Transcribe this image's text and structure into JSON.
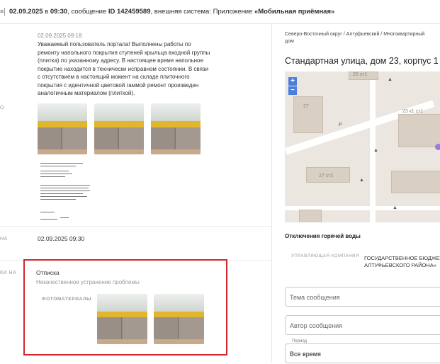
{
  "topbar": {
    "edge_icon": "≡",
    "date": "02.09.2025",
    "prep": "в",
    "time": "09:30",
    "msg_prefix": ", сообщение",
    "msg_id": "ID 142459589",
    "system_label": ", внешняя система: Приложение",
    "system_name": "«Мобильная приёмная»"
  },
  "message": {
    "date": "02.09.2025 09:18",
    "text": "Уважаемый пользователь портала! Выполнены работы по ремонту напольного покрытия ступеней крыльца входной группы (плитка) по указанному адресу. В настоящее время напольное покрытие находится в технически исправном состоянии. В связи с отсутствием в настоящий момент на складе плиточного покрытия с идентичной цветовой гаммой ремонт произведен аналогичным материалом (плиткой).",
    "side_letter": "О"
  },
  "status_row": {
    "side_label": "НА",
    "date": "02.09.2025 09:30"
  },
  "reply": {
    "side_label": "КИ НА",
    "title": "Отписка",
    "subtitle": "Некачественное устранение проблемы",
    "photos_label": "ФОТОМАТЕРИАЛЫ"
  },
  "right": {
    "address": "Северо-Восточный округ / Алтуфьевский / Многоквартирный дом",
    "street": "Стандартная улица, дом 23, корпус 1",
    "map": {
      "zoom_in": "+",
      "zoom_out": "−",
      "labels": [
        "25 ст1",
        "27",
        "23 к1 ст1",
        "27 ст2"
      ],
      "pin_glyph": "▲",
      "marker_glyph": "P"
    },
    "hot_water": "Отключения горячей воды",
    "mgmt_label": "УПРАВЛЯЮЩАЯ КОМПАНИЯ",
    "mgmt_line1": "ГОСУДАРСТВЕННОЕ БЮДЖЕТН",
    "mgmt_line2": "АЛТУФЬЕВСКОГО РАЙОНА»",
    "topic_placeholder": "Тема сообщения",
    "author_placeholder": "Автор сообщения",
    "period_label": "Период",
    "period_value": "Все время"
  },
  "colors": {
    "highlight_border": "#d0262b",
    "map_zoom": "#4a7de0",
    "stripe": "#e2b62a"
  }
}
